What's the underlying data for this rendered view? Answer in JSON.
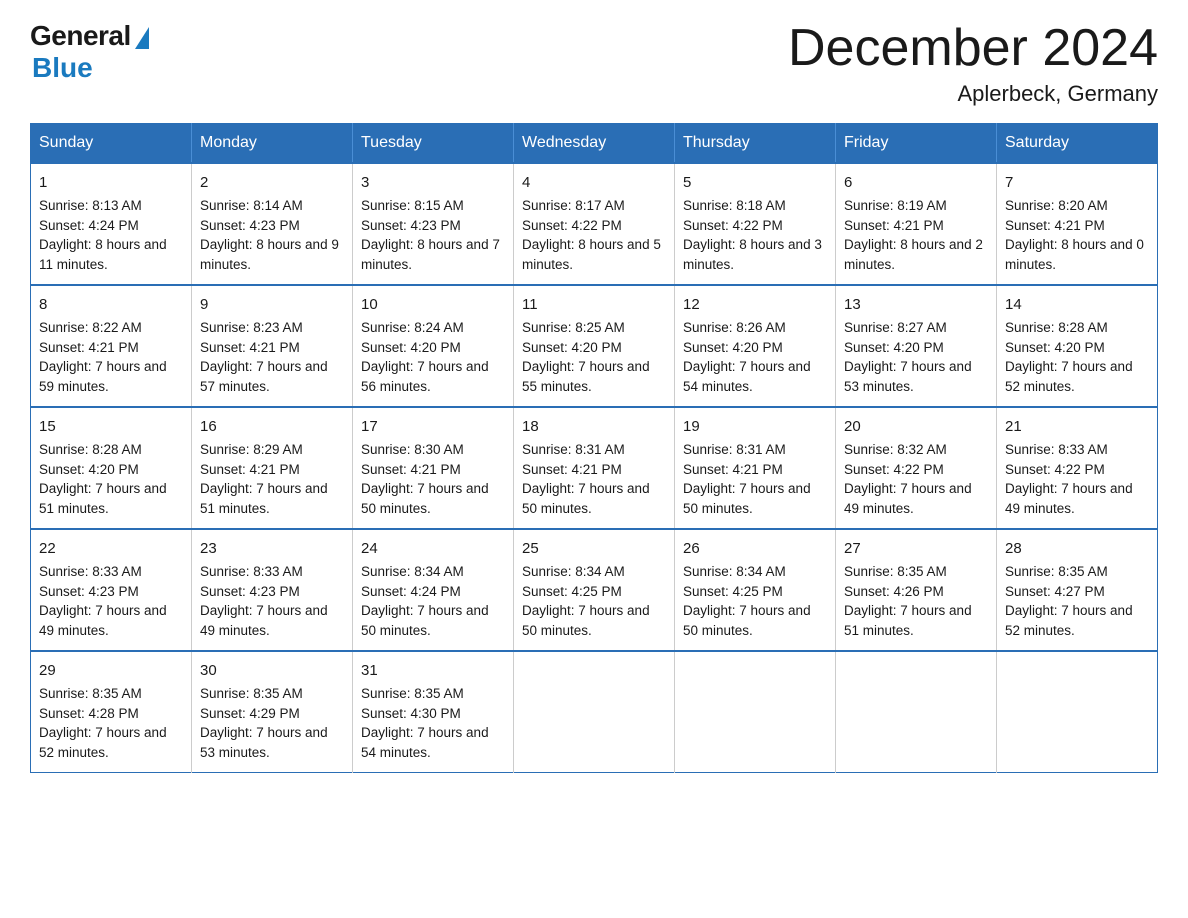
{
  "header": {
    "logo_general": "General",
    "logo_blue": "Blue",
    "month_title": "December 2024",
    "location": "Aplerbeck, Germany"
  },
  "weekdays": [
    "Sunday",
    "Monday",
    "Tuesday",
    "Wednesday",
    "Thursday",
    "Friday",
    "Saturday"
  ],
  "weeks": [
    [
      {
        "day": "1",
        "sunrise": "8:13 AM",
        "sunset": "4:24 PM",
        "daylight": "8 hours and 11 minutes."
      },
      {
        "day": "2",
        "sunrise": "8:14 AM",
        "sunset": "4:23 PM",
        "daylight": "8 hours and 9 minutes."
      },
      {
        "day": "3",
        "sunrise": "8:15 AM",
        "sunset": "4:23 PM",
        "daylight": "8 hours and 7 minutes."
      },
      {
        "day": "4",
        "sunrise": "8:17 AM",
        "sunset": "4:22 PM",
        "daylight": "8 hours and 5 minutes."
      },
      {
        "day": "5",
        "sunrise": "8:18 AM",
        "sunset": "4:22 PM",
        "daylight": "8 hours and 3 minutes."
      },
      {
        "day": "6",
        "sunrise": "8:19 AM",
        "sunset": "4:21 PM",
        "daylight": "8 hours and 2 minutes."
      },
      {
        "day": "7",
        "sunrise": "8:20 AM",
        "sunset": "4:21 PM",
        "daylight": "8 hours and 0 minutes."
      }
    ],
    [
      {
        "day": "8",
        "sunrise": "8:22 AM",
        "sunset": "4:21 PM",
        "daylight": "7 hours and 59 minutes."
      },
      {
        "day": "9",
        "sunrise": "8:23 AM",
        "sunset": "4:21 PM",
        "daylight": "7 hours and 57 minutes."
      },
      {
        "day": "10",
        "sunrise": "8:24 AM",
        "sunset": "4:20 PM",
        "daylight": "7 hours and 56 minutes."
      },
      {
        "day": "11",
        "sunrise": "8:25 AM",
        "sunset": "4:20 PM",
        "daylight": "7 hours and 55 minutes."
      },
      {
        "day": "12",
        "sunrise": "8:26 AM",
        "sunset": "4:20 PM",
        "daylight": "7 hours and 54 minutes."
      },
      {
        "day": "13",
        "sunrise": "8:27 AM",
        "sunset": "4:20 PM",
        "daylight": "7 hours and 53 minutes."
      },
      {
        "day": "14",
        "sunrise": "8:28 AM",
        "sunset": "4:20 PM",
        "daylight": "7 hours and 52 minutes."
      }
    ],
    [
      {
        "day": "15",
        "sunrise": "8:28 AM",
        "sunset": "4:20 PM",
        "daylight": "7 hours and 51 minutes."
      },
      {
        "day": "16",
        "sunrise": "8:29 AM",
        "sunset": "4:21 PM",
        "daylight": "7 hours and 51 minutes."
      },
      {
        "day": "17",
        "sunrise": "8:30 AM",
        "sunset": "4:21 PM",
        "daylight": "7 hours and 50 minutes."
      },
      {
        "day": "18",
        "sunrise": "8:31 AM",
        "sunset": "4:21 PM",
        "daylight": "7 hours and 50 minutes."
      },
      {
        "day": "19",
        "sunrise": "8:31 AM",
        "sunset": "4:21 PM",
        "daylight": "7 hours and 50 minutes."
      },
      {
        "day": "20",
        "sunrise": "8:32 AM",
        "sunset": "4:22 PM",
        "daylight": "7 hours and 49 minutes."
      },
      {
        "day": "21",
        "sunrise": "8:33 AM",
        "sunset": "4:22 PM",
        "daylight": "7 hours and 49 minutes."
      }
    ],
    [
      {
        "day": "22",
        "sunrise": "8:33 AM",
        "sunset": "4:23 PM",
        "daylight": "7 hours and 49 minutes."
      },
      {
        "day": "23",
        "sunrise": "8:33 AM",
        "sunset": "4:23 PM",
        "daylight": "7 hours and 49 minutes."
      },
      {
        "day": "24",
        "sunrise": "8:34 AM",
        "sunset": "4:24 PM",
        "daylight": "7 hours and 50 minutes."
      },
      {
        "day": "25",
        "sunrise": "8:34 AM",
        "sunset": "4:25 PM",
        "daylight": "7 hours and 50 minutes."
      },
      {
        "day": "26",
        "sunrise": "8:34 AM",
        "sunset": "4:25 PM",
        "daylight": "7 hours and 50 minutes."
      },
      {
        "day": "27",
        "sunrise": "8:35 AM",
        "sunset": "4:26 PM",
        "daylight": "7 hours and 51 minutes."
      },
      {
        "day": "28",
        "sunrise": "8:35 AM",
        "sunset": "4:27 PM",
        "daylight": "7 hours and 52 minutes."
      }
    ],
    [
      {
        "day": "29",
        "sunrise": "8:35 AM",
        "sunset": "4:28 PM",
        "daylight": "7 hours and 52 minutes."
      },
      {
        "day": "30",
        "sunrise": "8:35 AM",
        "sunset": "4:29 PM",
        "daylight": "7 hours and 53 minutes."
      },
      {
        "day": "31",
        "sunrise": "8:35 AM",
        "sunset": "4:30 PM",
        "daylight": "7 hours and 54 minutes."
      },
      null,
      null,
      null,
      null
    ]
  ]
}
